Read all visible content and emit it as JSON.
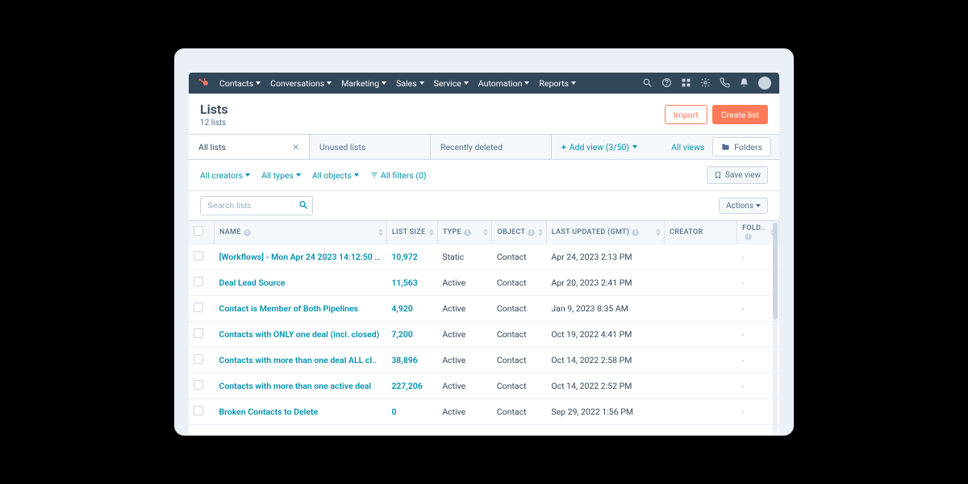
{
  "nav": {
    "items": [
      "Contacts",
      "Conversations",
      "Marketing",
      "Sales",
      "Service",
      "Automation",
      "Reports"
    ]
  },
  "page": {
    "title": "Lists",
    "subtitle": "12 lists",
    "import_label": "Import",
    "create_label": "Create list"
  },
  "tabs": {
    "all_lists": "All lists",
    "unused": "Unused lists",
    "recently_deleted": "Recently deleted",
    "add_view": "Add view (3/50)",
    "all_views": "All views",
    "folders": "Folders"
  },
  "filters": {
    "creators": "All creators",
    "types": "All types",
    "objects": "All objects",
    "all_filters": "All filters (0)",
    "save_view": "Save view"
  },
  "search": {
    "placeholder": "Search lists",
    "actions": "Actions"
  },
  "columns": {
    "name": "NAME",
    "size": "LIST SIZE",
    "type": "TYPE",
    "object": "OBJECT",
    "updated": "LAST UPDATED (GMT)",
    "creator": "CREATOR",
    "folder": "FOLD.."
  },
  "rows": [
    {
      "name": "[Workflows] - Mon Apr 24 2023 14:12:50 G…",
      "size": "10,972",
      "type": "Static",
      "object": "Contact",
      "updated": "Apr 24, 2023 2:13 PM",
      "creator": "",
      "folder": "-"
    },
    {
      "name": "Deal Lead Source",
      "size": "11,563",
      "type": "Active",
      "object": "Contact",
      "updated": "Apr 20, 2023 2:41 PM",
      "creator": "",
      "folder": "-"
    },
    {
      "name": "Contact is Member of Both Pipelines",
      "size": "4,920",
      "type": "Active",
      "object": "Contact",
      "updated": "Jan 9, 2023 8:35 AM",
      "creator": "",
      "folder": "-"
    },
    {
      "name": "Contacts with ONLY one deal (incl. closed)",
      "size": "7,200",
      "type": "Active",
      "object": "Contact",
      "updated": "Oct 19, 2022 4:41 PM",
      "creator": "",
      "folder": "-"
    },
    {
      "name": "Contacts with more than one deal ALL cl..",
      "size": "38,896",
      "type": "Active",
      "object": "Contact",
      "updated": "Oct 14, 2022 2:58 PM",
      "creator": "",
      "folder": "-"
    },
    {
      "name": "Contacts with more than one active deal",
      "size": "227,206",
      "type": "Active",
      "object": "Contact",
      "updated": "Oct 14, 2022 2:52 PM",
      "creator": "",
      "folder": "-"
    },
    {
      "name": "Broken Contacts to Delete",
      "size": "0",
      "type": "Active",
      "object": "Contact",
      "updated": "Sep 29, 2022 1:56 PM",
      "creator": "",
      "folder": "-"
    }
  ]
}
